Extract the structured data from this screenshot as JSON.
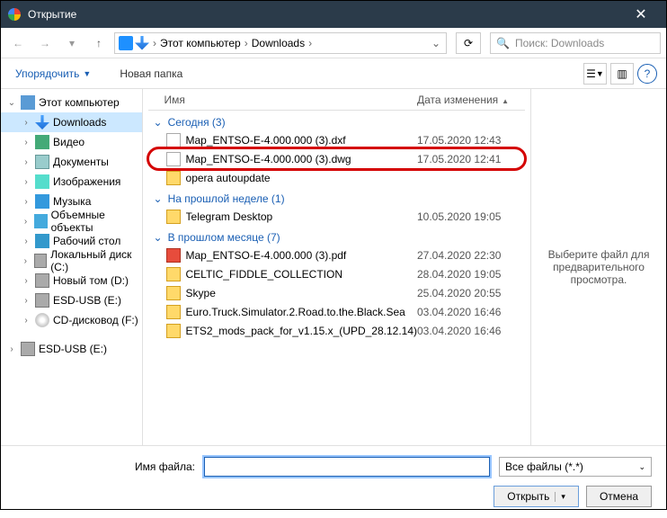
{
  "title": "Открытие",
  "breadcrumb": {
    "root": "Этот компьютер",
    "folder": "Downloads"
  },
  "search_placeholder": "Поиск: Downloads",
  "toolbar": {
    "organize": "Упорядочить",
    "newfolder": "Новая папка"
  },
  "columns": {
    "name": "Имя",
    "date": "Дата изменения"
  },
  "sidebar": {
    "pc": "Этот компьютер",
    "items": [
      "Downloads",
      "Видео",
      "Документы",
      "Изображения",
      "Музыка",
      "Объемные объекты",
      "Рабочий стол",
      "Локальный диск (C:)",
      "Новый том (D:)",
      "ESD-USB (E:)",
      "CD-дисковод (F:)"
    ],
    "extra": "ESD-USB (E:)"
  },
  "groups": [
    {
      "label": "Сегодня (3)",
      "items": [
        {
          "icon": "file",
          "name": "Map_ENTSO-E-4.000.000 (3).dxf",
          "date": "17.05.2020 12:43"
        },
        {
          "icon": "file",
          "name": "Map_ENTSO-E-4.000.000 (3).dwg",
          "date": "17.05.2020 12:41",
          "hl": true
        },
        {
          "icon": "folder",
          "name": "opera autoupdate",
          "date": ""
        }
      ]
    },
    {
      "label": "На прошлой неделе (1)",
      "items": [
        {
          "icon": "folder",
          "name": "Telegram Desktop",
          "date": "10.05.2020 19:05"
        }
      ]
    },
    {
      "label": "В прошлом месяце (7)",
      "items": [
        {
          "icon": "pdf",
          "name": "Map_ENTSO-E-4.000.000 (3).pdf",
          "date": "27.04.2020 22:30"
        },
        {
          "icon": "folder",
          "name": "CELTIC_FIDDLE_COLLECTION",
          "date": "28.04.2020 19:05"
        },
        {
          "icon": "folder",
          "name": "Skype",
          "date": "25.04.2020 20:55"
        },
        {
          "icon": "folder",
          "name": "Euro.Truck.Simulator.2.Road.to.the.Black.Sea",
          "date": "03.04.2020 16:46"
        },
        {
          "icon": "folder",
          "name": "ETS2_mods_pack_for_v1.15.x_(UPD_28.12.14)",
          "date": "03.04.2020 16:46"
        }
      ]
    }
  ],
  "preview": "Выберите файл для предварительного просмотра.",
  "filename_label": "Имя файла:",
  "filetype": "Все файлы (*.*)",
  "open": "Открыть",
  "cancel": "Отмена"
}
